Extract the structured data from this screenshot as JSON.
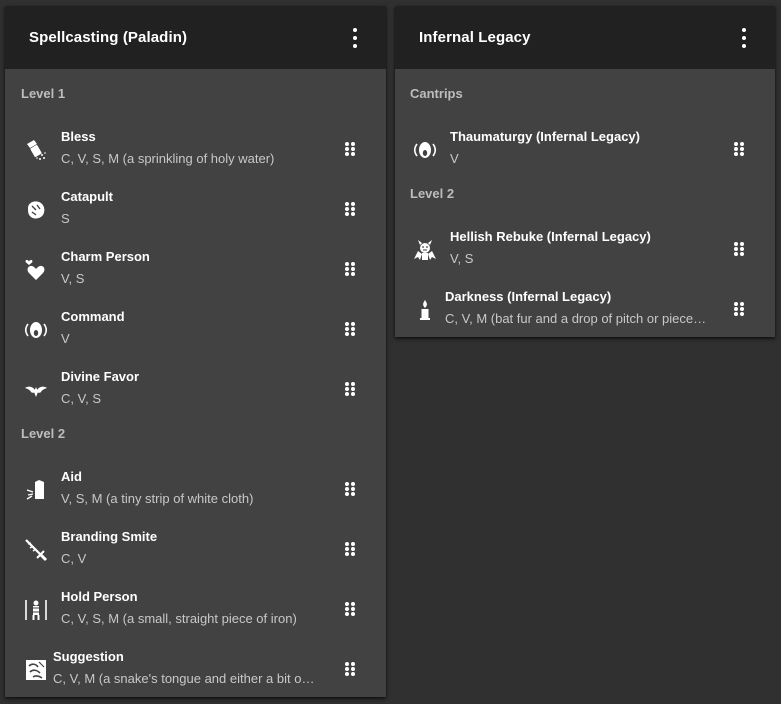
{
  "left_card": {
    "title": "Spellcasting (Paladin)",
    "sections": [
      {
        "label": "Level 1",
        "items": [
          {
            "name": "Bless",
            "desc": "C, V, S, M (a sprinkling of holy water)",
            "icon": "holy-water-icon"
          },
          {
            "name": "Catapult",
            "desc": "S",
            "icon": "catapult-icon"
          },
          {
            "name": "Charm Person",
            "desc": "V, S",
            "icon": "hearts-icon"
          },
          {
            "name": "Command",
            "desc": "V",
            "icon": "shout-icon"
          },
          {
            "name": "Divine Favor",
            "desc": "C, V, S",
            "icon": "winged-emblem-icon"
          }
        ]
      },
      {
        "label": "Level 2",
        "items": [
          {
            "name": "Aid",
            "desc": "V, S, M (a tiny strip of white cloth)",
            "icon": "aid-icon"
          },
          {
            "name": "Branding Smite",
            "desc": "C, V",
            "icon": "flaming-sword-icon"
          },
          {
            "name": "Hold Person",
            "desc": "C, V, S, M (a small, straight piece of iron)",
            "icon": "bound-person-icon"
          },
          {
            "name": "Suggestion",
            "desc": "C, V, M (a snake's tongue and either a bit of …",
            "icon": "suggestion-icon"
          }
        ]
      }
    ]
  },
  "right_card": {
    "title": "Infernal Legacy",
    "sections": [
      {
        "label": "Cantrips",
        "items": [
          {
            "name": "Thaumaturgy (Infernal Legacy)",
            "desc": "V",
            "icon": "shout-icon"
          }
        ]
      },
      {
        "label": "Level 2",
        "items": [
          {
            "name": "Hellish Rebuke (Infernal Legacy)",
            "desc": "V, S",
            "icon": "demon-icon"
          },
          {
            "name": "Darkness (Infernal Legacy)",
            "desc": "C, V, M (bat fur and a drop of pitch or piece …",
            "icon": "candle-icon"
          }
        ]
      }
    ]
  }
}
